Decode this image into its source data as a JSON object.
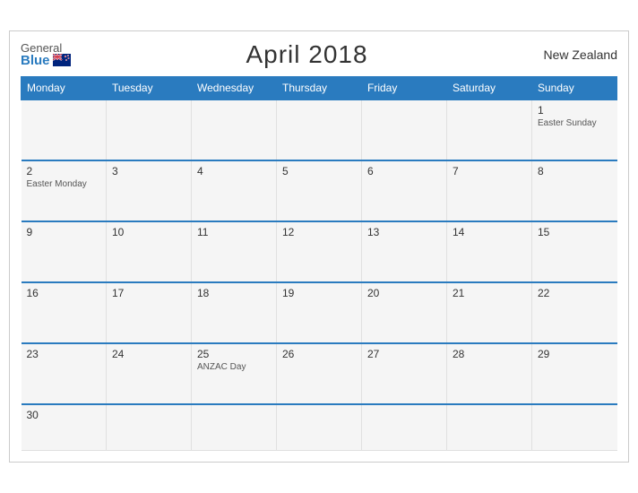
{
  "header": {
    "logo_general": "General",
    "logo_blue": "Blue",
    "title": "April 2018",
    "country": "New Zealand"
  },
  "days_of_week": [
    "Monday",
    "Tuesday",
    "Wednesday",
    "Thursday",
    "Friday",
    "Saturday",
    "Sunday"
  ],
  "weeks": [
    [
      {
        "num": "",
        "holiday": ""
      },
      {
        "num": "",
        "holiday": ""
      },
      {
        "num": "",
        "holiday": ""
      },
      {
        "num": "",
        "holiday": ""
      },
      {
        "num": "",
        "holiday": ""
      },
      {
        "num": "",
        "holiday": ""
      },
      {
        "num": "1",
        "holiday": "Easter Sunday"
      }
    ],
    [
      {
        "num": "2",
        "holiday": "Easter Monday"
      },
      {
        "num": "3",
        "holiday": ""
      },
      {
        "num": "4",
        "holiday": ""
      },
      {
        "num": "5",
        "holiday": ""
      },
      {
        "num": "6",
        "holiday": ""
      },
      {
        "num": "7",
        "holiday": ""
      },
      {
        "num": "8",
        "holiday": ""
      }
    ],
    [
      {
        "num": "9",
        "holiday": ""
      },
      {
        "num": "10",
        "holiday": ""
      },
      {
        "num": "11",
        "holiday": ""
      },
      {
        "num": "12",
        "holiday": ""
      },
      {
        "num": "13",
        "holiday": ""
      },
      {
        "num": "14",
        "holiday": ""
      },
      {
        "num": "15",
        "holiday": ""
      }
    ],
    [
      {
        "num": "16",
        "holiday": ""
      },
      {
        "num": "17",
        "holiday": ""
      },
      {
        "num": "18",
        "holiday": ""
      },
      {
        "num": "19",
        "holiday": ""
      },
      {
        "num": "20",
        "holiday": ""
      },
      {
        "num": "21",
        "holiday": ""
      },
      {
        "num": "22",
        "holiday": ""
      }
    ],
    [
      {
        "num": "23",
        "holiday": ""
      },
      {
        "num": "24",
        "holiday": ""
      },
      {
        "num": "25",
        "holiday": "ANZAC Day"
      },
      {
        "num": "26",
        "holiday": ""
      },
      {
        "num": "27",
        "holiday": ""
      },
      {
        "num": "28",
        "holiday": ""
      },
      {
        "num": "29",
        "holiday": ""
      }
    ],
    [
      {
        "num": "30",
        "holiday": ""
      },
      {
        "num": "",
        "holiday": ""
      },
      {
        "num": "",
        "holiday": ""
      },
      {
        "num": "",
        "holiday": ""
      },
      {
        "num": "",
        "holiday": ""
      },
      {
        "num": "",
        "holiday": ""
      },
      {
        "num": "",
        "holiday": ""
      }
    ]
  ]
}
